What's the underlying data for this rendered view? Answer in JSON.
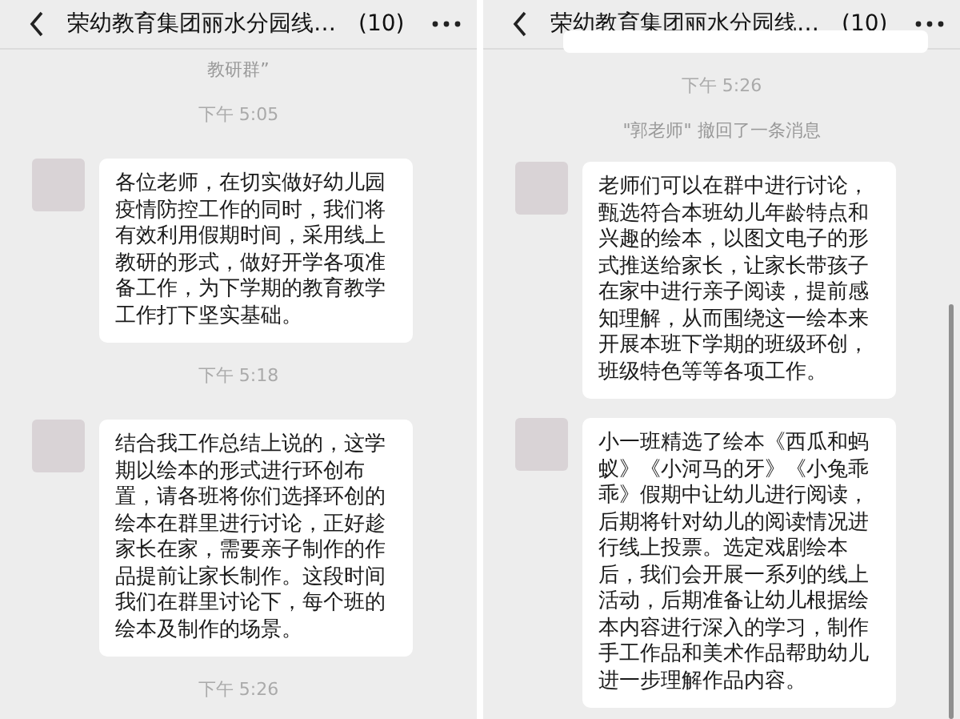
{
  "panels": [
    {
      "title": "荣幼教育集团丽水分园线…",
      "count": "(10)",
      "scrollbar": false,
      "items": [
        {
          "kind": "system",
          "text": "教研群”"
        },
        {
          "kind": "time",
          "text": "下午 5:05"
        },
        {
          "kind": "message",
          "text": "各位老师，在切实做好幼儿园疫情防控工作的同时，我们将有效利用假期时间，采用线上教研的形式，做好开学各项准备工作，为下学期的教育教学工作打下坚实基础。"
        },
        {
          "kind": "time",
          "text": "下午 5:18"
        },
        {
          "kind": "message",
          "text": "结合我工作总结上说的，这学期以绘本的形式进行环创布置，请各班将你们选择环创的绘本在群里进行讨论，正好趁家长在家，需要亲子制作的作品提前让家长制作。这段时间我们在群里讨论下，每个班的绘本及制作的场景。"
        },
        {
          "kind": "time",
          "text": "下午 5:26"
        }
      ]
    },
    {
      "title": "荣幼教育集团丽水分园线…",
      "count": "(10)",
      "scrollbar": true,
      "items": [
        {
          "kind": "bubble_edge"
        },
        {
          "kind": "time",
          "text": "下午 5:26"
        },
        {
          "kind": "system",
          "text": "\"郭老师\" 撤回了一条消息"
        },
        {
          "kind": "message",
          "text": "老师们可以在群中进行讨论，甄选符合本班幼儿年龄特点和兴趣的绘本，以图文电子的形式推送给家长，让家长带孩子在家中进行亲子阅读，提前感知理解，从而围绕这一绘本来开展本班下学期的班级环创，班级特色等等各项工作。"
        },
        {
          "kind": "message",
          "text": "小一班精选了绘本《西瓜和蚂蚁》《小河马的牙》《小兔乖乖》假期中让幼儿进行阅读，后期将针对幼儿的阅读情况进行线上投票。选定戏剧绘本后，我们会开展一系列的线上活动，后期准备让幼儿根据绘本内容进行深入的学习，制作手工作品和美术作品帮助幼儿进一步理解作品内容。"
        }
      ]
    }
  ]
}
